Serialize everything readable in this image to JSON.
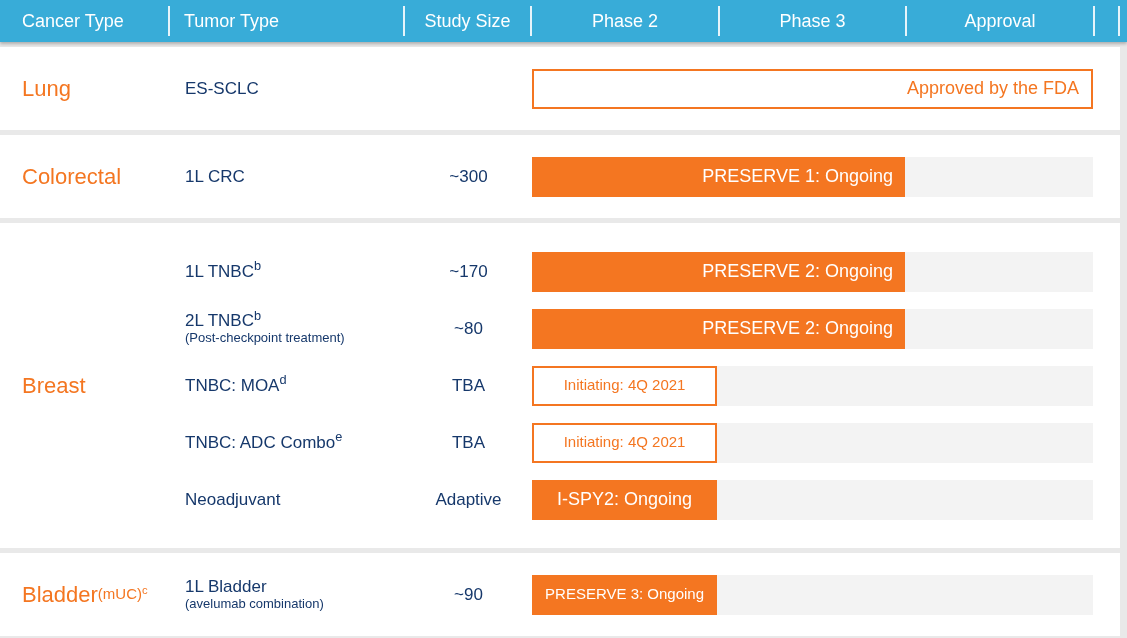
{
  "header": [
    "Cancer Type",
    "Tumor Type",
    "Study Size",
    "Phase 2",
    "Phase 3",
    "Approval"
  ],
  "groups": [
    {
      "cancer": "Lung",
      "rows": [
        {
          "tumor": "ES-SCLC",
          "bar": {
            "label": "Approved by the FDA",
            "kind": "outline",
            "level": 1
          }
        }
      ]
    },
    {
      "cancer": "Colorectal",
      "rows": [
        {
          "tumor": "1L CRC",
          "size": "~300",
          "bar": {
            "label": "PRESERVE 1: Ongoing",
            "kind": "filled",
            "level": 0.665
          }
        }
      ]
    },
    {
      "cancer": "Breast",
      "rows": [
        {
          "tumor": "1L TNBC$^{b}$",
          "size": "~170",
          "bar": {
            "label": "PRESERVE 2: Ongoing",
            "kind": "filled",
            "level": 0.665
          }
        },
        {
          "tumor": "2L TNBC$^{b}$",
          "note": "(Post-checkpoint treatment)",
          "size": "~80",
          "bar": {
            "label": "PRESERVE 2: Ongoing",
            "kind": "filled",
            "level": 0.665
          }
        },
        {
          "tumor": "TNBC: MOA$^{d}$",
          "size": "TBA",
          "bar": {
            "label": "Initiating: 4Q 2021",
            "kind": "outline",
            "level": 0.33
          }
        },
        {
          "tumor": "TNBC: ADC Combo$^{e}$",
          "size": "TBA",
          "bar": {
            "label": "Initiating: 4Q 2021",
            "kind": "outline",
            "level": 0.33
          }
        },
        {
          "tumor": "Neoadjuvant",
          "size": "Adaptive",
          "bar": {
            "label": "I-SPY2: Ongoing",
            "kind": "filled",
            "level": 0.33
          }
        }
      ]
    },
    {
      "cancer": "Bladder",
      "qualifier": "(mUC)$^{c}$",
      "rows": [
        {
          "tumor": "1L Bladder",
          "note": "(avelumab combination)",
          "size": "~90",
          "bar": {
            "label": "PRESERVE 3: Ongoing",
            "kind": "filled",
            "level": 0.33
          }
        }
      ]
    }
  ]
}
